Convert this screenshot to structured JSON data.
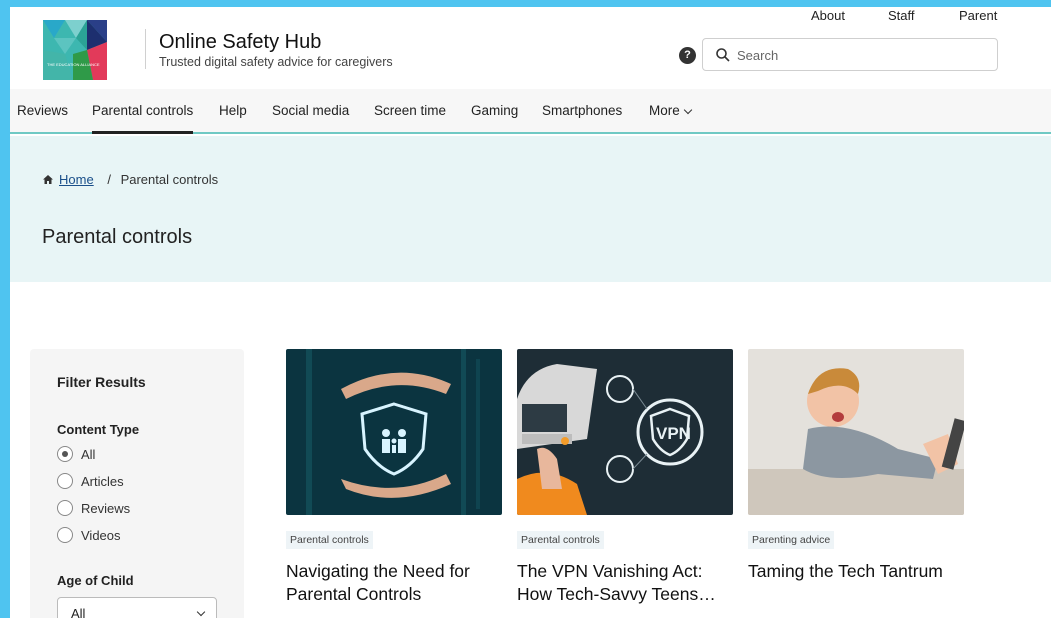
{
  "site": {
    "title": "Online Safety Hub",
    "subtitle": "Trusted digital safety advice for caregivers",
    "logo_text": "THE EDUCATION ALLIANCE"
  },
  "toplinks": [
    "About",
    "Staff",
    "Parent"
  ],
  "help_icon_label": "?",
  "search": {
    "placeholder": "Search"
  },
  "nav": {
    "items": [
      "Reviews",
      "Parental controls",
      "Help",
      "Social media",
      "Screen time",
      "Gaming",
      "Smartphones",
      "More"
    ],
    "active": "Parental controls"
  },
  "breadcrumb": {
    "home": "Home",
    "separator": "/",
    "current": "Parental controls"
  },
  "page_title": "Parental controls",
  "filter": {
    "title": "Filter Results",
    "content_type": {
      "label": "Content Type",
      "options": [
        "All",
        "Articles",
        "Reviews",
        "Videos"
      ],
      "selected": "All"
    },
    "age": {
      "label": "Age of Child",
      "selected": "All"
    }
  },
  "cards": [
    {
      "tag": "Parental controls",
      "title": "Navigating the Need for Parental Controls",
      "image_text": ""
    },
    {
      "tag": "Parental controls",
      "title": "The VPN Vanishing Act: How Tech-Savvy Teens…",
      "image_text": "VPN"
    },
    {
      "tag": "Parenting advice",
      "title": "Taming the Tech Tantrum",
      "image_text": ""
    }
  ],
  "colors": {
    "accent_teal": "#6fc9c4",
    "hero_bg": "#e8f5f6",
    "link": "#1a4f8a",
    "outer_border": "#4fc4f0"
  }
}
